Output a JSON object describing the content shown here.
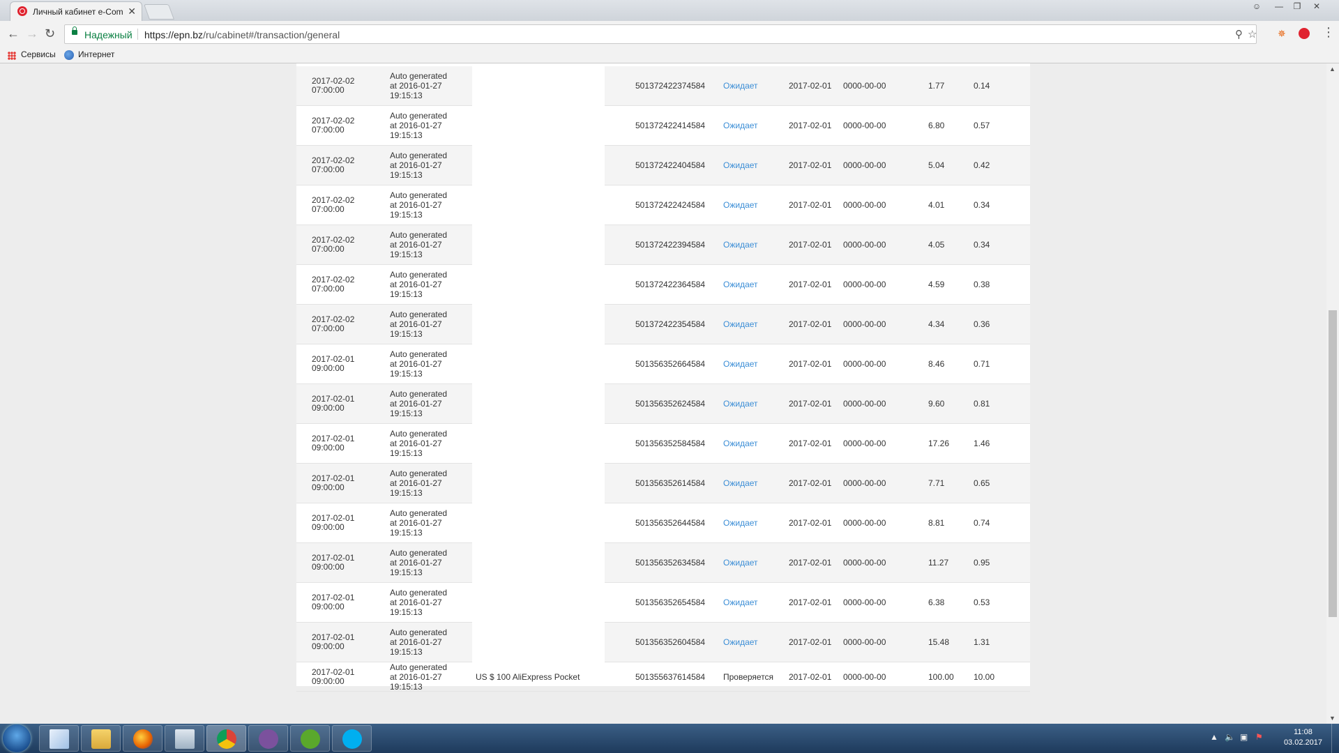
{
  "browser": {
    "tab_title": "Личный кабинет e-Com",
    "tab_close": "✕",
    "secure_label": "Надежный",
    "url_host": "https://epn.bz",
    "url_path": "/ru/cabinet#/transaction/general",
    "bookmarks": {
      "apps": "Сервисы",
      "internet": "Интернет"
    }
  },
  "transactions": [
    {
      "date": "2017-02-02",
      "time": "07:00:00",
      "comment": [
        "Auto generated",
        "at 2016-01-27",
        "19:15:13"
      ],
      "offer": "",
      "order": "501372422374584",
      "status": "Ожидает",
      "date_created": "2017-02-01",
      "date_confirmed": "0000-00-00",
      "amount": "1.77",
      "commission": "0.14"
    },
    {
      "date": "2017-02-02",
      "time": "07:00:00",
      "comment": [
        "Auto generated",
        "at 2016-01-27",
        "19:15:13"
      ],
      "offer": "",
      "order": "501372422414584",
      "status": "Ожидает",
      "date_created": "2017-02-01",
      "date_confirmed": "0000-00-00",
      "amount": "6.80",
      "commission": "0.57"
    },
    {
      "date": "2017-02-02",
      "time": "07:00:00",
      "comment": [
        "Auto generated",
        "at 2016-01-27",
        "19:15:13"
      ],
      "offer": "",
      "order": "501372422404584",
      "status": "Ожидает",
      "date_created": "2017-02-01",
      "date_confirmed": "0000-00-00",
      "amount": "5.04",
      "commission": "0.42"
    },
    {
      "date": "2017-02-02",
      "time": "07:00:00",
      "comment": [
        "Auto generated",
        "at 2016-01-27",
        "19:15:13"
      ],
      "offer": "",
      "order": "501372422424584",
      "status": "Ожидает",
      "date_created": "2017-02-01",
      "date_confirmed": "0000-00-00",
      "amount": "4.01",
      "commission": "0.34"
    },
    {
      "date": "2017-02-02",
      "time": "07:00:00",
      "comment": [
        "Auto generated",
        "at 2016-01-27",
        "19:15:13"
      ],
      "offer": "",
      "order": "501372422394584",
      "status": "Ожидает",
      "date_created": "2017-02-01",
      "date_confirmed": "0000-00-00",
      "amount": "4.05",
      "commission": "0.34"
    },
    {
      "date": "2017-02-02",
      "time": "07:00:00",
      "comment": [
        "Auto generated",
        "at 2016-01-27",
        "19:15:13"
      ],
      "offer": "",
      "order": "501372422364584",
      "status": "Ожидает",
      "date_created": "2017-02-01",
      "date_confirmed": "0000-00-00",
      "amount": "4.59",
      "commission": "0.38"
    },
    {
      "date": "2017-02-02",
      "time": "07:00:00",
      "comment": [
        "Auto generated",
        "at 2016-01-27",
        "19:15:13"
      ],
      "offer": "",
      "order": "501372422354584",
      "status": "Ожидает",
      "date_created": "2017-02-01",
      "date_confirmed": "0000-00-00",
      "amount": "4.34",
      "commission": "0.36"
    },
    {
      "date": "2017-02-01",
      "time": "09:00:00",
      "comment": [
        "Auto generated",
        "at 2016-01-27",
        "19:15:13"
      ],
      "offer": "",
      "order": "501356352664584",
      "status": "Ожидает",
      "date_created": "2017-02-01",
      "date_confirmed": "0000-00-00",
      "amount": "8.46",
      "commission": "0.71"
    },
    {
      "date": "2017-02-01",
      "time": "09:00:00",
      "comment": [
        "Auto generated",
        "at 2016-01-27",
        "19:15:13"
      ],
      "offer": "",
      "order": "501356352624584",
      "status": "Ожидает",
      "date_created": "2017-02-01",
      "date_confirmed": "0000-00-00",
      "amount": "9.60",
      "commission": "0.81"
    },
    {
      "date": "2017-02-01",
      "time": "09:00:00",
      "comment": [
        "Auto generated",
        "at 2016-01-27",
        "19:15:13"
      ],
      "offer": "",
      "order": "501356352584584",
      "status": "Ожидает",
      "date_created": "2017-02-01",
      "date_confirmed": "0000-00-00",
      "amount": "17.26",
      "commission": "1.46"
    },
    {
      "date": "2017-02-01",
      "time": "09:00:00",
      "comment": [
        "Auto generated",
        "at 2016-01-27",
        "19:15:13"
      ],
      "offer": "",
      "order": "501356352614584",
      "status": "Ожидает",
      "date_created": "2017-02-01",
      "date_confirmed": "0000-00-00",
      "amount": "7.71",
      "commission": "0.65"
    },
    {
      "date": "2017-02-01",
      "time": "09:00:00",
      "comment": [
        "Auto generated",
        "at 2016-01-27",
        "19:15:13"
      ],
      "offer": "",
      "order": "501356352644584",
      "status": "Ожидает",
      "date_created": "2017-02-01",
      "date_confirmed": "0000-00-00",
      "amount": "8.81",
      "commission": "0.74"
    },
    {
      "date": "2017-02-01",
      "time": "09:00:00",
      "comment": [
        "Auto generated",
        "at 2016-01-27",
        "19:15:13"
      ],
      "offer": "",
      "order": "501356352634584",
      "status": "Ожидает",
      "date_created": "2017-02-01",
      "date_confirmed": "0000-00-00",
      "amount": "11.27",
      "commission": "0.95"
    },
    {
      "date": "2017-02-01",
      "time": "09:00:00",
      "comment": [
        "Auto generated",
        "at 2016-01-27",
        "19:15:13"
      ],
      "offer": "",
      "order": "501356352654584",
      "status": "Ожидает",
      "date_created": "2017-02-01",
      "date_confirmed": "0000-00-00",
      "amount": "6.38",
      "commission": "0.53"
    },
    {
      "date": "2017-02-01",
      "time": "09:00:00",
      "comment": [
        "Auto generated",
        "at 2016-01-27",
        "19:15:13"
      ],
      "offer": "",
      "order": "501356352604584",
      "status": "Ожидает",
      "date_created": "2017-02-01",
      "date_confirmed": "0000-00-00",
      "amount": "15.48",
      "commission": "1.31"
    },
    {
      "date": "2017-02-01",
      "time": "09:00:00",
      "comment": [
        "Auto generated",
        "at 2016-01-27",
        "19:15:13"
      ],
      "offer": "US $ 100 AliExpress Pocket",
      "order": "501355637614584",
      "status": "Проверяется",
      "date_created": "2017-02-01",
      "date_confirmed": "0000-00-00",
      "amount": "100.00",
      "commission": "10.00"
    }
  ],
  "colors": {
    "status_pending": "#3a8dd6",
    "status_checking": "#333333",
    "secure": "#0b8043"
  },
  "taskbar": {
    "apps": [
      "windows-explorer",
      "file-manager",
      "firefox",
      "calculator",
      "chrome",
      "viber",
      "utorrent",
      "skype"
    ],
    "clock_time": "11:08",
    "clock_date": "03.02.2017"
  }
}
